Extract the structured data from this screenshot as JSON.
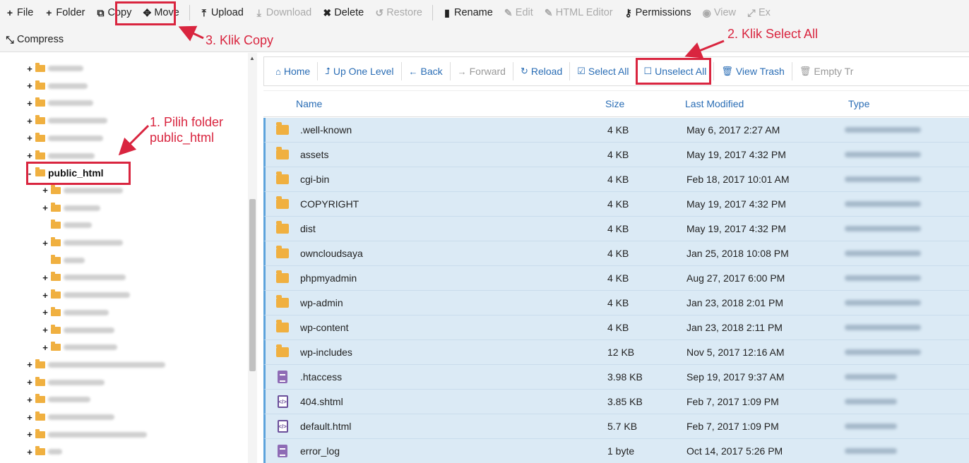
{
  "toolbar": {
    "row1": [
      {
        "id": "file",
        "icon": "plus-icon",
        "glyph": "+",
        "label": "File",
        "disabled": false
      },
      {
        "id": "folder",
        "icon": "plus-icon",
        "glyph": "+",
        "label": "Folder",
        "disabled": false
      },
      {
        "id": "copy",
        "icon": "copy-icon",
        "glyph": "⧉",
        "label": "Copy",
        "disabled": false
      },
      {
        "id": "move",
        "icon": "move-icon",
        "glyph": "✥",
        "label": "Move",
        "disabled": false
      },
      {
        "id": "upload",
        "icon": "upload-icon",
        "glyph": "⤒",
        "label": "Upload",
        "disabled": false
      },
      {
        "id": "download",
        "icon": "download-icon",
        "glyph": "⤓",
        "label": "Download",
        "disabled": true
      },
      {
        "id": "delete",
        "icon": "close-icon",
        "glyph": "✖",
        "label": "Delete",
        "disabled": false
      },
      {
        "id": "restore",
        "icon": "restore-icon",
        "glyph": "↺",
        "label": "Restore",
        "disabled": true
      },
      {
        "id": "rename",
        "icon": "file-icon",
        "glyph": "▮",
        "label": "Rename",
        "disabled": false
      },
      {
        "id": "edit",
        "icon": "pencil-icon",
        "glyph": "✎",
        "label": "Edit",
        "disabled": true
      },
      {
        "id": "html-editor",
        "icon": "edit-square-icon",
        "glyph": "✎",
        "label": "HTML Editor",
        "disabled": true
      },
      {
        "id": "permissions",
        "icon": "key-icon",
        "glyph": "⚷",
        "label": "Permissions",
        "disabled": false
      },
      {
        "id": "view",
        "icon": "eye-icon",
        "glyph": "◉",
        "label": "View",
        "disabled": true
      },
      {
        "id": "extract",
        "icon": "expand-icon",
        "glyph": "⤢",
        "label": "Ex",
        "disabled": true
      }
    ],
    "row2": [
      {
        "id": "compress",
        "icon": "compress-icon",
        "glyph": "⤡",
        "label": "Compress",
        "disabled": false
      }
    ]
  },
  "nav": [
    {
      "id": "home",
      "icon": "home-icon",
      "glyph": "⌂",
      "label": "Home",
      "disabled": false
    },
    {
      "id": "up-one-level",
      "icon": "level-up-icon",
      "glyph": "⮥",
      "label": "Up One Level",
      "disabled": false
    },
    {
      "id": "back",
      "icon": "arrow-left-icon",
      "glyph": "←",
      "label": "Back",
      "disabled": false
    },
    {
      "id": "forward",
      "icon": "arrow-right-icon",
      "glyph": "→",
      "label": "Forward",
      "disabled": true
    },
    {
      "id": "reload",
      "icon": "reload-icon",
      "glyph": "↻",
      "label": "Reload",
      "disabled": false
    },
    {
      "id": "select-all",
      "icon": "checkbox-checked-icon",
      "glyph": "☑",
      "label": "Select All",
      "disabled": false
    },
    {
      "id": "unselect-all",
      "icon": "checkbox-empty-icon",
      "glyph": "☐",
      "label": "Unselect All",
      "disabled": false
    },
    {
      "id": "view-trash",
      "icon": "trash-icon",
      "glyph": "🗑",
      "label": "View Trash",
      "disabled": false
    },
    {
      "id": "empty-trash",
      "icon": "trash-icon",
      "glyph": "🗑",
      "label": "Empty Tr",
      "disabled": true
    }
  ],
  "table": {
    "headers": {
      "name": "Name",
      "size": "Size",
      "modified": "Last Modified",
      "type": "Type"
    },
    "rows": [
      {
        "kind": "folder",
        "name": ".well-known",
        "size": "4 KB",
        "modified": "May 6, 2017 2:27 AM"
      },
      {
        "kind": "folder",
        "name": "assets",
        "size": "4 KB",
        "modified": "May 19, 2017 4:32 PM"
      },
      {
        "kind": "folder",
        "name": "cgi-bin",
        "size": "4 KB",
        "modified": "Feb 18, 2017 10:01 AM"
      },
      {
        "kind": "folder",
        "name": "COPYRIGHT",
        "size": "4 KB",
        "modified": "May 19, 2017 4:32 PM"
      },
      {
        "kind": "folder",
        "name": "dist",
        "size": "4 KB",
        "modified": "May 19, 2017 4:32 PM"
      },
      {
        "kind": "folder",
        "name": "owncloudsaya",
        "size": "4 KB",
        "modified": "Jan 25, 2018 10:08 PM"
      },
      {
        "kind": "folder",
        "name": "phpmyadmin",
        "size": "4 KB",
        "modified": "Aug 27, 2017 6:00 PM"
      },
      {
        "kind": "folder",
        "name": "wp-admin",
        "size": "4 KB",
        "modified": "Jan 23, 2018 2:01 PM"
      },
      {
        "kind": "folder",
        "name": "wp-content",
        "size": "4 KB",
        "modified": "Jan 23, 2018 2:11 PM"
      },
      {
        "kind": "folder",
        "name": "wp-includes",
        "size": "12 KB",
        "modified": "Nov 5, 2017 12:16 AM"
      },
      {
        "kind": "text",
        "name": ".htaccess",
        "size": "3.98 KB",
        "modified": "Sep 19, 2017 9:37 AM"
      },
      {
        "kind": "code",
        "name": "404.shtml",
        "size": "3.85 KB",
        "modified": "Feb 7, 2017 1:09 PM"
      },
      {
        "kind": "code",
        "name": "default.html",
        "size": "5.7 KB",
        "modified": "Feb 7, 2017 1:09 PM"
      },
      {
        "kind": "text",
        "name": "error_log",
        "size": "1 byte",
        "modified": "Oct 14, 2017 5:26 PM"
      }
    ]
  },
  "tree": {
    "selected_label": "public_html",
    "items": [
      {
        "toggle": "+",
        "indent": 0,
        "blur_w": 50
      },
      {
        "toggle": "+",
        "indent": 0,
        "blur_w": 56
      },
      {
        "toggle": "+",
        "indent": 0,
        "blur_w": 64
      },
      {
        "toggle": "+",
        "indent": 0,
        "blur_w": 84
      },
      {
        "toggle": "+",
        "indent": 0,
        "blur_w": 78
      },
      {
        "toggle": "+",
        "indent": 0,
        "blur_w": 66
      },
      {
        "toggle": "-",
        "indent": 0,
        "selected": true
      },
      {
        "toggle": "+",
        "indent": 1,
        "blur_w": 84
      },
      {
        "toggle": "+",
        "indent": 1,
        "blur_w": 52
      },
      {
        "toggle": "",
        "indent": 1,
        "blur_w": 40
      },
      {
        "toggle": "+",
        "indent": 1,
        "blur_w": 84
      },
      {
        "toggle": "",
        "indent": 1,
        "blur_w": 30
      },
      {
        "toggle": "+",
        "indent": 1,
        "blur_w": 88
      },
      {
        "toggle": "+",
        "indent": 1,
        "blur_w": 94
      },
      {
        "toggle": "+",
        "indent": 1,
        "blur_w": 64
      },
      {
        "toggle": "+",
        "indent": 1,
        "blur_w": 72
      },
      {
        "toggle": "+",
        "indent": 1,
        "blur_w": 76
      },
      {
        "toggle": "+",
        "indent": 0,
        "blur_w": 166
      },
      {
        "toggle": "+",
        "indent": 0,
        "blur_w": 80
      },
      {
        "toggle": "+",
        "indent": 0,
        "blur_w": 60
      },
      {
        "toggle": "+",
        "indent": 0,
        "blur_w": 94
      },
      {
        "toggle": "+",
        "indent": 0,
        "blur_w": 140
      },
      {
        "toggle": "+",
        "indent": 0,
        "blur_w": 20
      }
    ]
  },
  "annotations": {
    "step1_line1": "1. Pilih folder",
    "step1_line2": "public_html",
    "step2": "2. Klik Select All",
    "step3": "3. Klik Copy",
    "color": "#d9253f"
  },
  "colors": {
    "link": "#2a6db5",
    "selected_row": "#dbeaf5",
    "folder": "#f0b040",
    "annotation": "#d9253f"
  }
}
